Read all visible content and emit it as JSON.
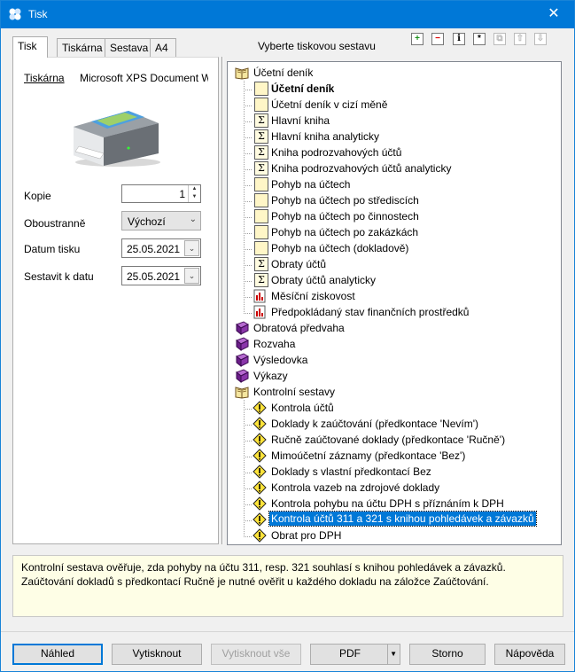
{
  "window": {
    "title": "Tisk",
    "close_glyph": "✕"
  },
  "tabs": [
    "Tisk",
    "Tiskárna",
    "Sestava",
    "A4"
  ],
  "left": {
    "printer_label": "Tiskárna",
    "printer_name": "Microsoft XPS Document Writer",
    "copies_label": "Kopie",
    "copies_value": "1",
    "duplex_label": "Oboustranně",
    "duplex_value": "Výchozí",
    "print_date_label": "Datum tisku",
    "print_date_value": "25.05.2021",
    "build_date_label": "Sestavit k datu",
    "build_date_value": "25.05.2021"
  },
  "tree_header": "Vyberte tiskovou sestavu",
  "toolbar": {
    "add": "+",
    "remove": "−",
    "info": "i",
    "star": "*",
    "copy_icon": "copy-icon",
    "up_icon": "arrow-up-icon",
    "down_icon": "arrow-down-icon"
  },
  "tree": [
    {
      "label": "Účetní deník",
      "icon": "book-open",
      "level": 0
    },
    {
      "label": "Účetní deník",
      "icon": "doc",
      "level": 1,
      "bold": true
    },
    {
      "label": "Účetní deník v cizí měně",
      "icon": "doc",
      "level": 1
    },
    {
      "label": "Hlavní kniha",
      "icon": "sigma",
      "level": 1
    },
    {
      "label": "Hlavní kniha analyticky",
      "icon": "sigma",
      "level": 1
    },
    {
      "label": "Kniha podrozvahových účtů",
      "icon": "sigma",
      "level": 1
    },
    {
      "label": "Kniha podrozvahových účtů analyticky",
      "icon": "sigma",
      "level": 1
    },
    {
      "label": "Pohyb na účtech",
      "icon": "doc",
      "level": 1
    },
    {
      "label": "Pohyb na účtech po střediscích",
      "icon": "doc",
      "level": 1
    },
    {
      "label": "Pohyb na účtech po činnostech",
      "icon": "doc",
      "level": 1
    },
    {
      "label": "Pohyb na účtech po zakázkách",
      "icon": "doc",
      "level": 1
    },
    {
      "label": "Pohyb na účtech (dokladově)",
      "icon": "doc",
      "level": 1
    },
    {
      "label": "Obraty účtů",
      "icon": "sigma",
      "level": 1
    },
    {
      "label": "Obraty účtů analyticky",
      "icon": "sigma",
      "level": 1
    },
    {
      "label": "Měsíční ziskovost",
      "icon": "chart",
      "level": 1
    },
    {
      "label": "Předpokládaný stav finančních prostředků",
      "icon": "chart",
      "level": 1
    },
    {
      "label": "Obratová předvaha",
      "icon": "book-closed",
      "level": 0
    },
    {
      "label": "Rozvaha",
      "icon": "book-closed",
      "level": 0
    },
    {
      "label": "Výsledovka",
      "icon": "book-closed",
      "level": 0
    },
    {
      "label": "Výkazy",
      "icon": "book-closed",
      "level": 0
    },
    {
      "label": "Kontrolní sestavy",
      "icon": "book-open",
      "level": 0
    },
    {
      "label": "Kontrola účtů",
      "icon": "warn",
      "level": 1
    },
    {
      "label": "Doklady k zaúčtování (předkontace 'Nevím')",
      "icon": "warn",
      "level": 1
    },
    {
      "label": "Ručně zaúčtované doklady (předkontace 'Ručně')",
      "icon": "warn",
      "level": 1
    },
    {
      "label": "Mimoúčetní záznamy (předkontace 'Bez')",
      "icon": "warn",
      "level": 1
    },
    {
      "label": "Doklady s vlastní předkontací Bez",
      "icon": "warn",
      "level": 1
    },
    {
      "label": "Kontrola vazeb na zdrojové doklady",
      "icon": "warn",
      "level": 1
    },
    {
      "label": "Kontrola pohybu na účtu DPH s příznáním k DPH",
      "icon": "warn",
      "level": 1
    },
    {
      "label": "Kontrola účtů 311 a 321 s knihou pohledávek a závazků",
      "icon": "warn",
      "level": 1,
      "selected": true
    },
    {
      "label": "Obrat pro DPH",
      "icon": "warn",
      "level": 1
    }
  ],
  "description": "Kontrolní sestava ověřuje, zda pohyby na účtu 311, resp. 321 souhlasí s knihou pohledávek a závazků. Zaúčtování dokladů s předkontací Ručně je nutné ověřit u každého dokladu na záložce Zaúčtování.",
  "buttons": {
    "preview": "Náhled",
    "print": "Vytisknout",
    "print_all": "Vytisknout vše",
    "pdf": "PDF",
    "cancel": "Storno",
    "help": "Nápověda"
  },
  "colors": {
    "titlebar": "#0078d7",
    "selection": "#0078d7",
    "description_bg": "#fefee6"
  }
}
